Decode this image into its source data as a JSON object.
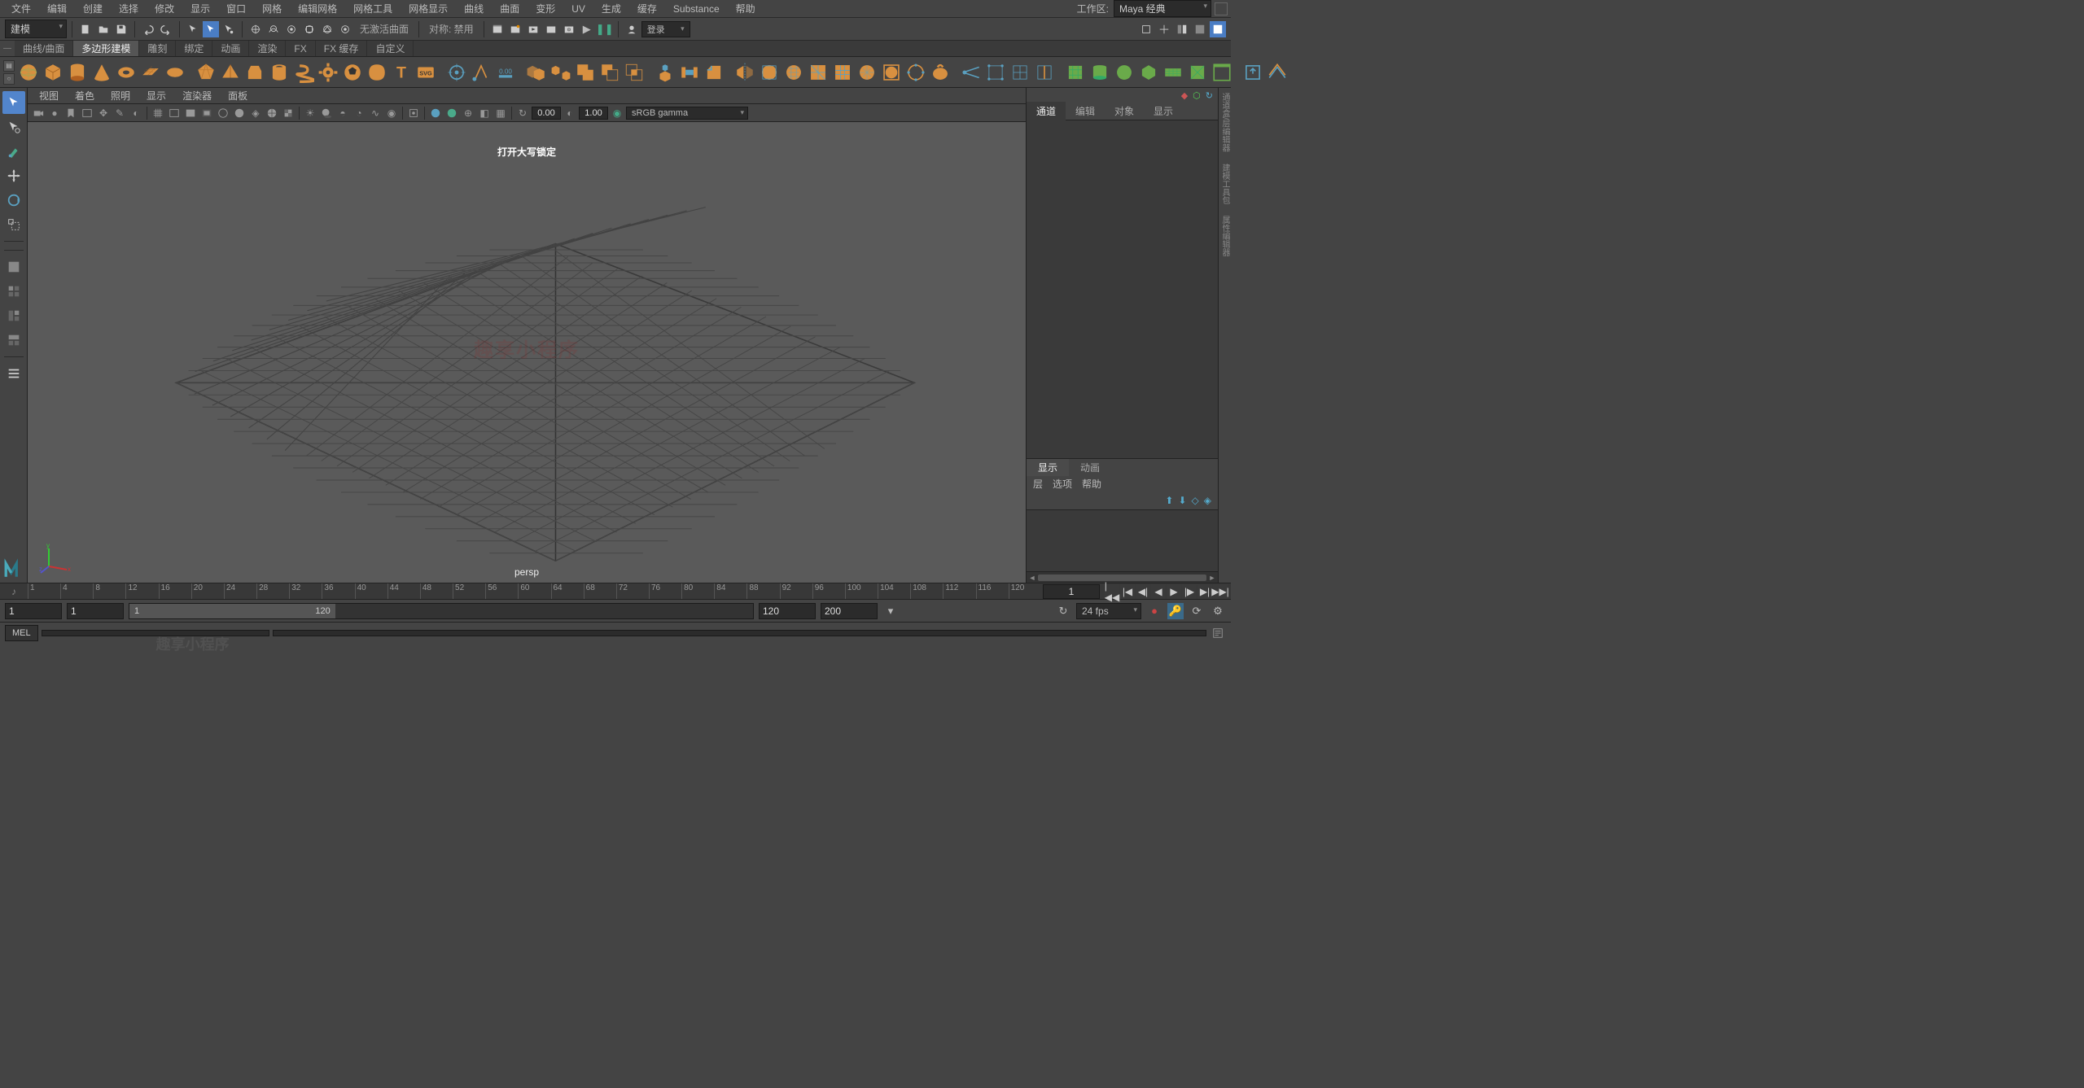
{
  "menubar": {
    "items": [
      "文件",
      "编辑",
      "创建",
      "选择",
      "修改",
      "显示",
      "窗口",
      "网格",
      "编辑网格",
      "网格工具",
      "网格显示",
      "曲线",
      "曲面",
      "变形",
      "UV",
      "生成",
      "缓存",
      "Substance",
      "帮助"
    ],
    "workspace_label": "工作区:",
    "workspace_value": "Maya 经典"
  },
  "statusline": {
    "mode": "建模",
    "no_active_label": "无激活曲面",
    "symmetry_label": "对称: 禁用",
    "user_label": "登录"
  },
  "shelf": {
    "tabs": [
      "曲线/曲面",
      "多边形建模",
      "雕刻",
      "绑定",
      "动画",
      "渲染",
      "FX",
      "FX 缓存",
      "自定义"
    ],
    "active_tab_index": 1
  },
  "panel_menu": [
    "视图",
    "着色",
    "照明",
    "显示",
    "渲染器",
    "面板"
  ],
  "panel_toolbar": {
    "num1": "0.00",
    "num2": "1.00",
    "colorspace": "sRGB gamma"
  },
  "viewport": {
    "caps_lock_msg": "打开大写锁定",
    "watermark": "趣享小程序",
    "camera": "persp"
  },
  "channelbox": {
    "tabs": [
      "通道",
      "编辑",
      "对象",
      "显示"
    ]
  },
  "layers": {
    "tabs": [
      "显示",
      "动画"
    ],
    "menu": [
      "层",
      "选项",
      "帮助"
    ]
  },
  "side_tabs": [
    "通道盒/层编辑器",
    "建模工具包",
    "属性编辑器"
  ],
  "timeslider": {
    "ticks": [
      "1",
      "4",
      "8",
      "12",
      "16",
      "20",
      "24",
      "28",
      "32",
      "36",
      "40",
      "44",
      "48",
      "52",
      "56",
      "60",
      "64",
      "68",
      "72",
      "76",
      "80",
      "84",
      "88",
      "92",
      "96",
      "100",
      "104",
      "108",
      "112",
      "116",
      "120"
    ],
    "current": "1"
  },
  "range": {
    "start_outer": "1",
    "start_inner": "1",
    "fill_start": "1",
    "fill_end": "120",
    "end_inner": "120",
    "end_outer": "200",
    "fps": "24 fps"
  },
  "cmdline": {
    "lang": "MEL",
    "watermark": "趣享小程序"
  }
}
